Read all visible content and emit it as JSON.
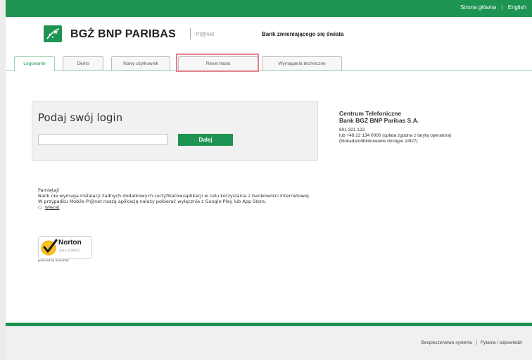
{
  "topbar": {
    "home_link": "Strona główna",
    "separator": "|",
    "english_link": "English"
  },
  "brand": {
    "name": "BGŻ BNP PARIBAS",
    "product": "Pl@net",
    "slogan": "Bank zmieniającego się świata"
  },
  "tabs": [
    {
      "label": "Logowanie",
      "active": true
    },
    {
      "label": "Demo",
      "active": false
    },
    {
      "label": "Nowy użytkownik",
      "active": false
    },
    {
      "label": "Reset hasła",
      "active": false
    },
    {
      "label": "Wymagania techniczne",
      "active": false
    }
  ],
  "login": {
    "title": "Podaj swój login",
    "input_value": "",
    "button_label": "Dalej"
  },
  "contact": {
    "title1": "Centrum Telefoniczne",
    "title2": "Bank BGŻ BNP Paribas S.A.",
    "line1": "801 321 123",
    "line2": "lub +48 22 134 0000 (opłata zgodna z taryfą operatora)",
    "line3": "(blokada/odblokowanie dostępu 24h/7)"
  },
  "notice": {
    "heading": "Pamiętaj!",
    "line1": "Bank nie wymaga instalacji żadnych dodatkowych certyfikatów/aplikacji w celu korzystania z bankowości internetowej.",
    "line2": "W przypadku Mobile Pl@net naszą aplikację należy pobierać wyłącznie z Google Play lub App Store.",
    "more_bullet": "○",
    "more_link": "więcej"
  },
  "norton": {
    "name": "Norton",
    "secured": "SECURED",
    "powered": "powered by Symantec"
  },
  "footer": {
    "security_link": "Bezpieczeństwo systemu",
    "separator": "|",
    "faq_link": "Pytania i odpowiedzi"
  },
  "colors": {
    "brand_green": "#1e9452",
    "highlight": "#e1848e"
  }
}
